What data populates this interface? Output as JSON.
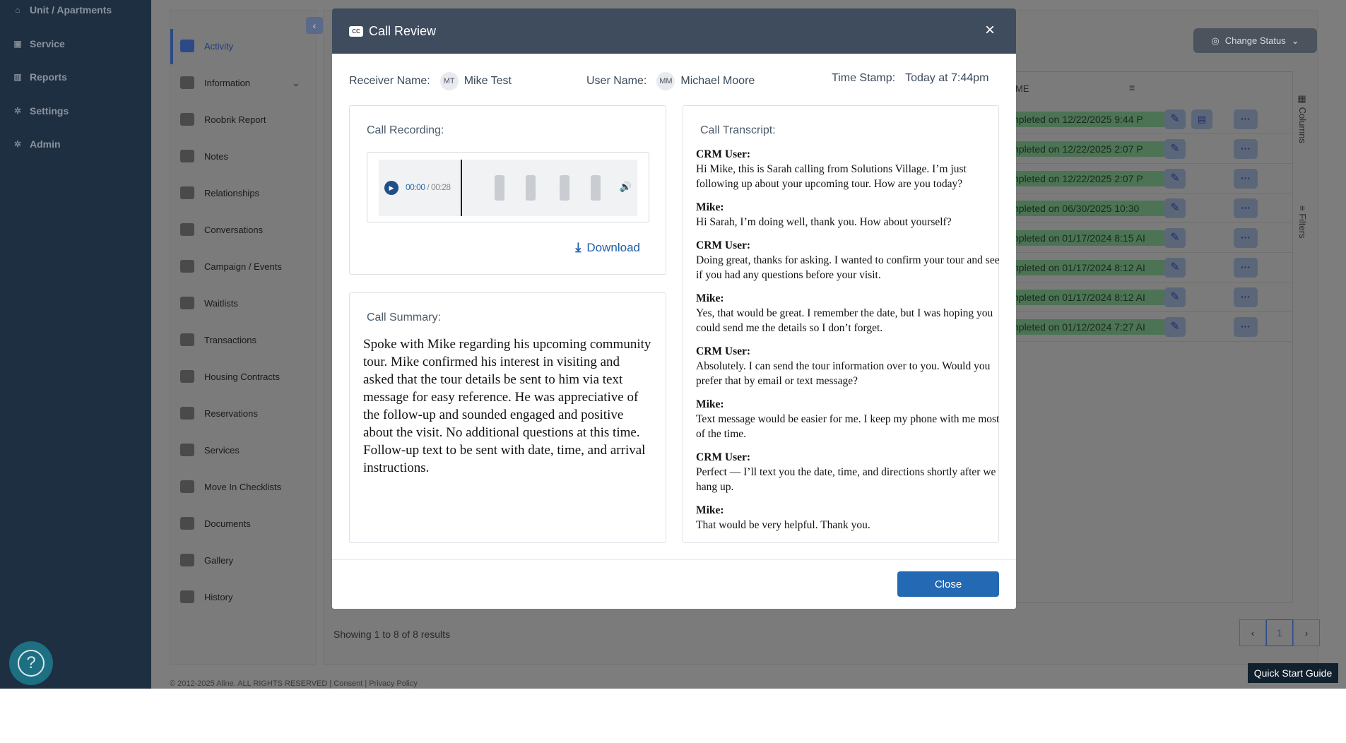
{
  "leftnav": {
    "items": [
      {
        "label": "Unit / Apartments",
        "icon": "home-icon"
      },
      {
        "label": "Service",
        "icon": "briefcase-icon"
      },
      {
        "label": "Reports",
        "icon": "bar-chart-icon"
      },
      {
        "label": "Settings",
        "icon": "gear-icon"
      },
      {
        "label": "Admin",
        "icon": "gears-icon"
      }
    ]
  },
  "subnav": {
    "items": [
      {
        "label": "Activity",
        "icon": "list-icon"
      },
      {
        "label": "Information",
        "icon": "id-card-icon"
      },
      {
        "label": "Roobrik Report",
        "icon": "grid-icon"
      },
      {
        "label": "Notes",
        "icon": "clipboard-icon"
      },
      {
        "label": "Relationships",
        "icon": "users-icon"
      },
      {
        "label": "Conversations",
        "icon": "chat-icon"
      },
      {
        "label": "Campaign / Events",
        "icon": "megaphone-icon"
      },
      {
        "label": "Waitlists",
        "icon": "clipboard-list-icon"
      },
      {
        "label": "Transactions",
        "icon": "exchange-icon"
      },
      {
        "label": "Housing Contracts",
        "icon": "house-icon"
      },
      {
        "label": "Reservations",
        "icon": "bed-icon"
      },
      {
        "label": "Services",
        "icon": "tiles-icon"
      },
      {
        "label": "Move In Checklists",
        "icon": "checklist-icon"
      },
      {
        "label": "Documents",
        "icon": "documents-icon"
      },
      {
        "label": "Gallery",
        "icon": "images-icon"
      },
      {
        "label": "History",
        "icon": "history-icon"
      }
    ]
  },
  "background": {
    "change_status": "Change Status",
    "table_header": "ME",
    "rows": [
      "npleted on 12/22/2025 9:44 P",
      "npleted on 12/22/2025 2:07 P",
      "npleted on 12/22/2025 2:07 P",
      "npleted on 06/30/2025 10:30",
      "npleted on 01/17/2024 8:15 AI",
      "npleted on 01/17/2024 8:12 AI",
      "npleted on 01/17/2024 8:12 AI",
      "npleted on 01/12/2024 7:27 AI"
    ],
    "side_tabs": [
      "Columns",
      "Filters"
    ],
    "showing": "Showing 1 to 8 of 8 results",
    "page": "1",
    "quick_start": "Quick Start Guide",
    "footer": "© 2012-2025 Aline. ALL RIGHTS RESERVED | Consent | Privacy Policy"
  },
  "modal": {
    "title": "Call Review",
    "receiver_label": "Receiver Name:",
    "receiver_initials": "MT",
    "receiver_name": "Mike Test",
    "user_label": "User Name:",
    "user_initials": "MM",
    "user_name": "Michael Moore",
    "timestamp_label": "Time Stamp:",
    "timestamp": "Today at 7:44pm",
    "recording_label": "Call Recording:",
    "player": {
      "current": "00:00",
      "total": "/ 00:28"
    },
    "download": "Download",
    "summary_label": "Call Summary:",
    "summary": "Spoke with Mike regarding his upcoming community tour. Mike confirmed his interest in visiting and asked that the tour details be sent to him via text message for easy reference. He was appreciative of the follow-up and sounded engaged and positive about the visit. No additional questions at this time. Follow-up text to be sent with date, time, and arrival instructions.",
    "transcript_label": "Call Transcript:",
    "transcript": [
      {
        "speaker": "CRM User:",
        "text": "Hi Mike, this is Sarah calling from Solutions Village. I’m just following up about your upcoming tour. How are you today?"
      },
      {
        "speaker": "Mike:",
        "text": "Hi Sarah, I’m doing well, thank you. How about yourself?"
      },
      {
        "speaker": "CRM User:",
        "text": "Doing great, thanks for asking. I wanted to confirm your tour and see if you had any questions before your visit."
      },
      {
        "speaker": "Mike:",
        "text": "Yes, that would be great. I remember the date, but I was hoping you could send me the details so I don’t forget."
      },
      {
        "speaker": "CRM User:",
        "text": "Absolutely. I can send the tour information over to you. Would you prefer that by email or text message?"
      },
      {
        "speaker": "Mike:",
        "text": "Text message would be easier for me. I keep my phone with me most of the time."
      },
      {
        "speaker": "CRM User:",
        "text": "Perfect — I’ll text you the date, time, and directions shortly after we hang up."
      },
      {
        "speaker": "Mike:",
        "text": "That would be very helpful. Thank you."
      }
    ],
    "close": "Close"
  }
}
